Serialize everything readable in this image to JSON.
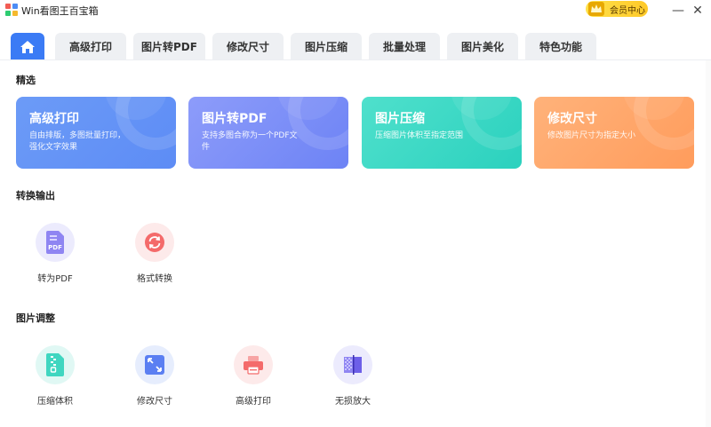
{
  "window": {
    "title": "Win看图王百宝箱",
    "vip_label": "会员中心",
    "minimize": "—",
    "close": "✕"
  },
  "tabs": [
    {
      "label": ""
    },
    {
      "label": "高级打印"
    },
    {
      "label": "图片转PDF"
    },
    {
      "label": "修改尺寸"
    },
    {
      "label": "图片压缩"
    },
    {
      "label": "批量处理"
    },
    {
      "label": "图片美化"
    },
    {
      "label": "特色功能"
    }
  ],
  "sections": {
    "featured": "精选",
    "convert": "转换输出",
    "adjust": "图片调整"
  },
  "cards": [
    {
      "title": "高级打印",
      "desc": "自由排版，多图批量打印，强化文字效果",
      "color1": "#6c9bf7",
      "color2": "#5d8cf5"
    },
    {
      "title": "图片转PDF",
      "desc": "支持多图合称为一个PDF文件",
      "color1": "#8d9cfa",
      "color2": "#6d83f5"
    },
    {
      "title": "图片压缩",
      "desc": "压缩图片体积至指定范围",
      "color1": "#4fe0cc",
      "color2": "#2bd1be"
    },
    {
      "title": "修改尺寸",
      "desc": "修改图片尺寸为指定大小",
      "color1": "#ffb27a",
      "color2": "#ff9c5c"
    }
  ],
  "convert_tools": [
    {
      "label": "转为PDF",
      "icon": "pdf-icon",
      "bg": "#ecebfd"
    },
    {
      "label": "格式转换",
      "icon": "convert-icon",
      "bg": "#fdeaea"
    }
  ],
  "adjust_tools": [
    {
      "label": "压缩体积",
      "icon": "compress-icon",
      "bg": "#e0f8f4"
    },
    {
      "label": "修改尺寸",
      "icon": "resize-icon",
      "bg": "#e6edfd"
    },
    {
      "label": "高级打印",
      "icon": "printer-icon",
      "bg": "#fdeaea"
    },
    {
      "label": "无损放大",
      "icon": "enlarge-icon",
      "bg": "#ecebfd"
    }
  ],
  "icon_text": {
    "pdf": "PDF"
  }
}
